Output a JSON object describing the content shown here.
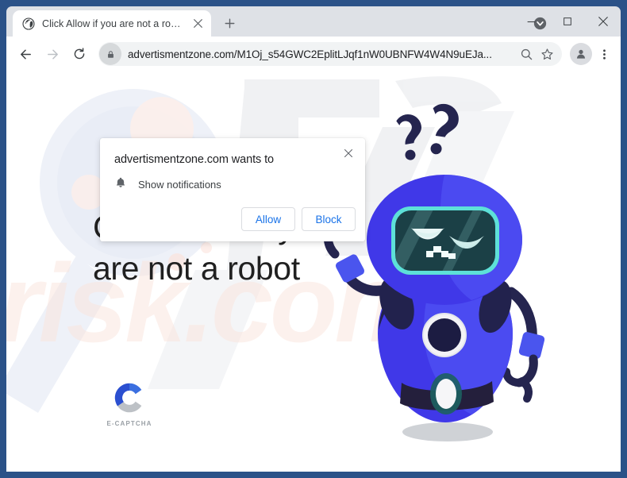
{
  "window": {
    "frame_color": "#2b5288",
    "caption_buttons": [
      {
        "name": "minimize",
        "glyph": "minimize-icon"
      },
      {
        "name": "maximize",
        "glyph": "maximize-icon"
      },
      {
        "name": "close",
        "glyph": "close-icon"
      }
    ]
  },
  "tabstrip": {
    "tab": {
      "title": "Click Allow if you are not a robot",
      "favicon": "globe-icon",
      "close": "close-icon"
    },
    "new_tab": "plus-icon",
    "profile_chip": "chevron-down-circle-icon"
  },
  "toolbar": {
    "back": "arrow-left-icon",
    "forward": "arrow-right-icon",
    "reload": "reload-icon",
    "lock": "lock-icon",
    "url_host": "advertismentzone.com",
    "url_path": "/M1Oj_s54GWC2EplitLJqf1nW0UBNFW4W4N9uEJa...",
    "url_full": "advertismentzone.com/M1Oj_s54GWC2EplitLJqf1nW0UBNFW4W4N9uEJa...",
    "zoom_search": "search-icon",
    "bookmark": "star-icon",
    "avatar": "person-icon",
    "menu": "kebab-menu-icon"
  },
  "dialog": {
    "title": "advertismentzone.com wants to",
    "close": "close-icon",
    "permission_icon": "bell-icon",
    "permission_label": "Show notifications",
    "allow_label": "Allow",
    "block_label": "Block",
    "button_text_color": "#1a73e8"
  },
  "page": {
    "headline": "Click Allow if you are not a robot",
    "captcha": {
      "mark": "c-logo-icon",
      "label": "E-CAPTCHA",
      "color_primary": "#2b4fd0",
      "color_secondary": "#4a86f5",
      "color_tertiary": "#bdc1c6"
    },
    "robot": {
      "name": "confused-robot-illustration",
      "question_marks": "??",
      "body_color": "#4038e8",
      "body_color_light": "#4d58f0",
      "limb_color": "#25254f",
      "visor_color": "#1b4046",
      "visor_border_color": "#5de0d8"
    },
    "watermark": {
      "text": "risk.com",
      "logo": "pc-monogram"
    }
  }
}
